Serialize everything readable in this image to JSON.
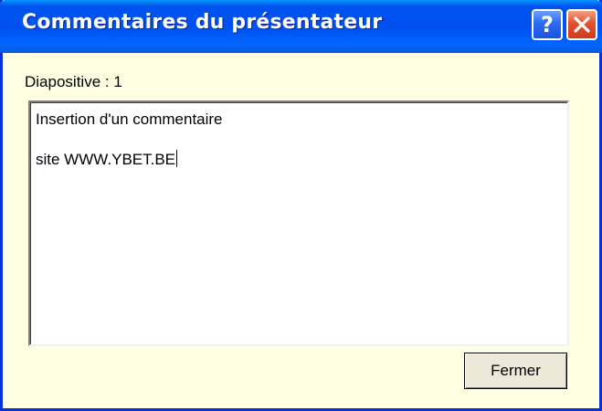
{
  "window": {
    "title": "Commentaires du présentateur",
    "help_glyph": "?",
    "icons": {
      "help": "help-icon",
      "close": "close-x-icon"
    },
    "colors": {
      "titlebar": "#0050ee",
      "close_button": "#e3502c",
      "background": "#ffffe1"
    }
  },
  "dialog": {
    "slide_label": "Diapositive : 1",
    "notes_lines": [
      "Insertion d'un commentaire",
      "",
      "site WWW.YBET.BE"
    ],
    "close_label": "Fermer"
  }
}
